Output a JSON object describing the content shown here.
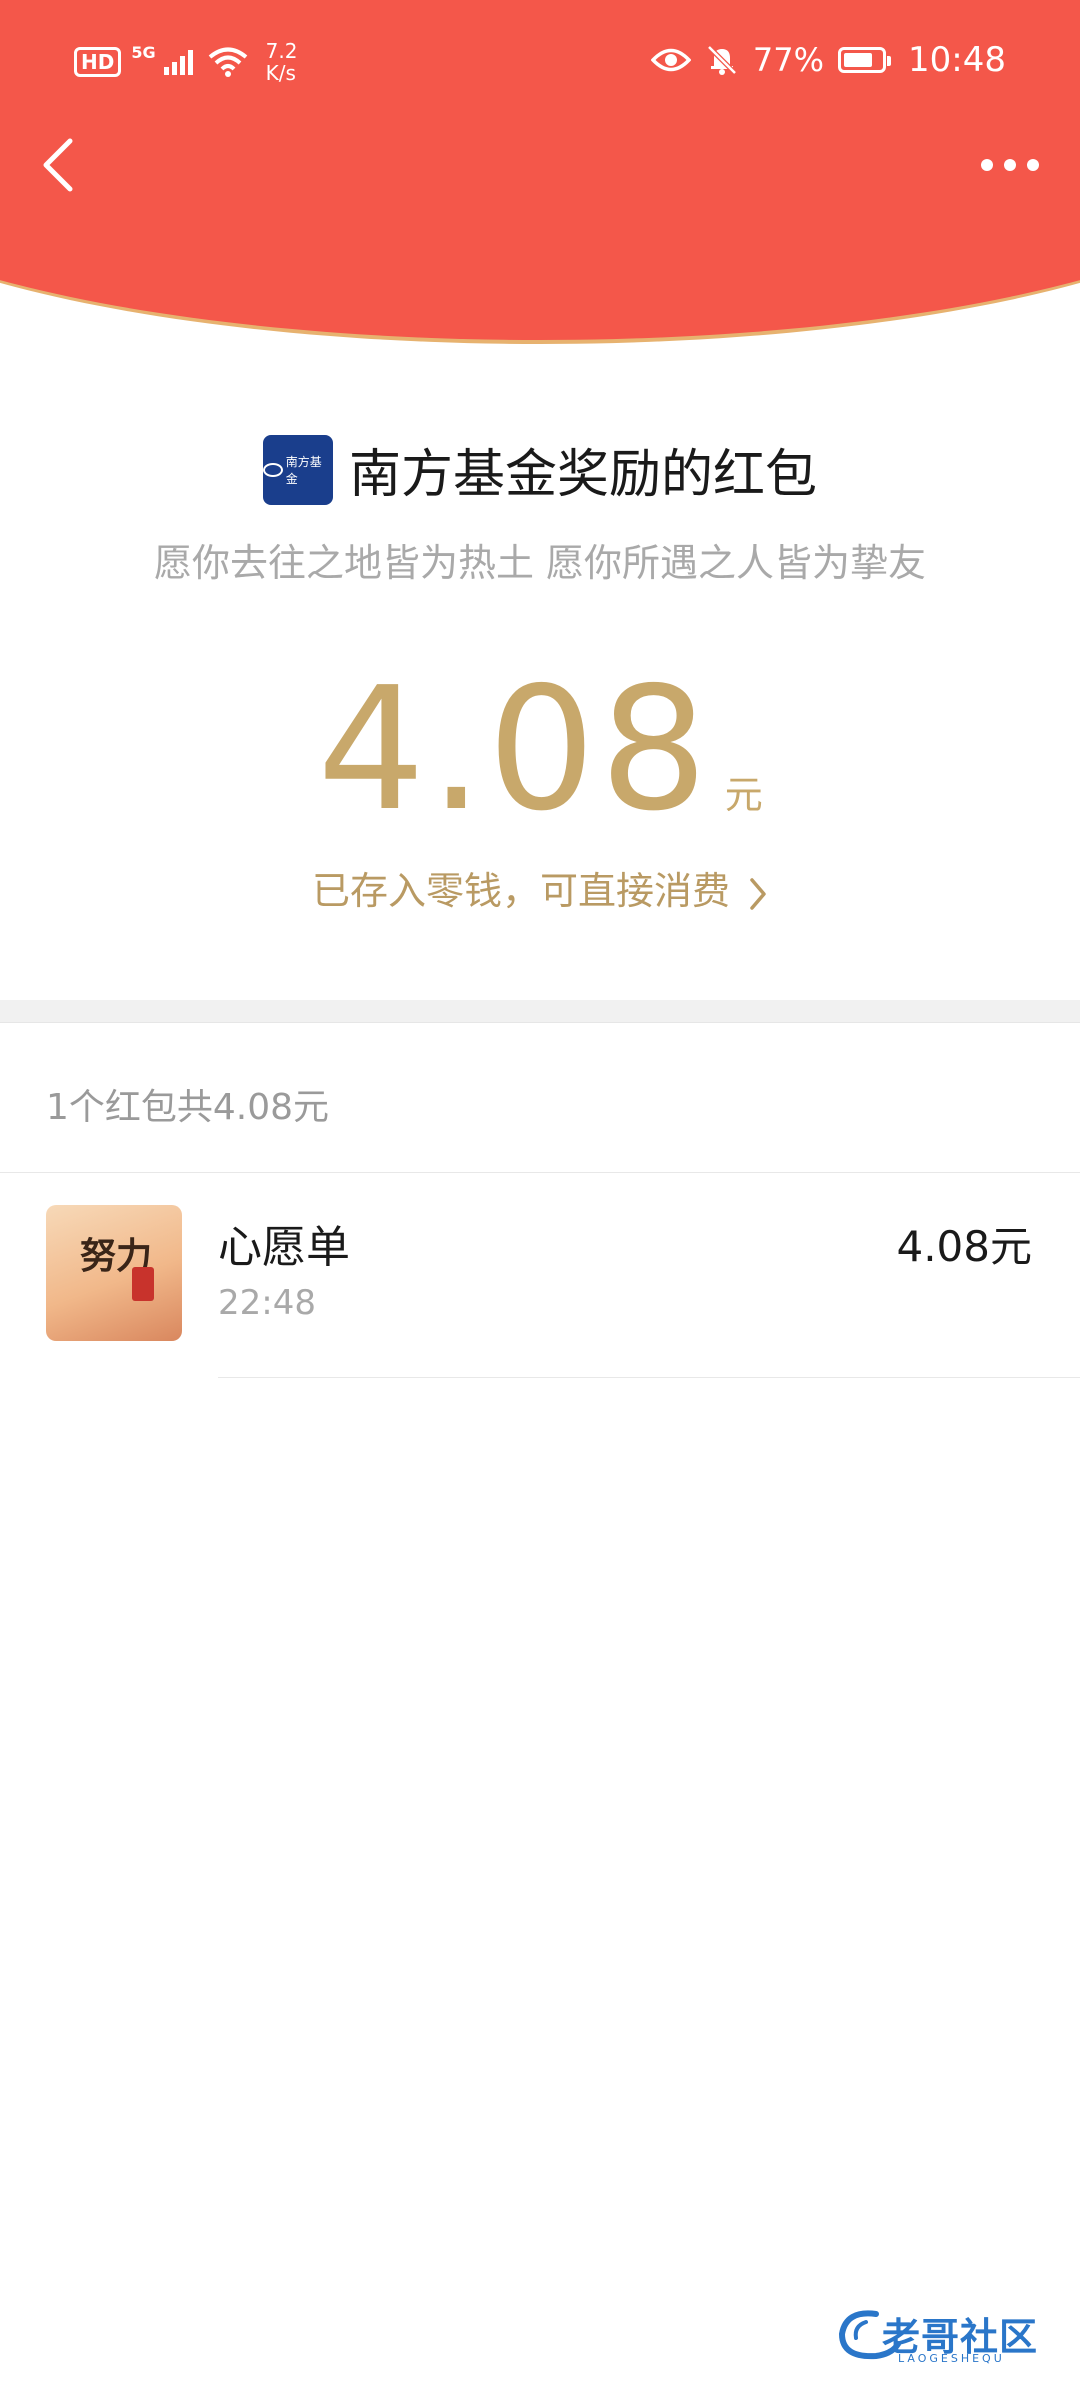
{
  "status_bar": {
    "hd": "HD",
    "network": "5G",
    "speed_value": "7.2",
    "speed_unit": "K/s",
    "battery": "77%",
    "battery_level": 0.77,
    "time": "10:48"
  },
  "nav": {
    "back_icon": "chevron-left-icon",
    "more_icon": "more-horizontal-icon"
  },
  "header": {
    "sender_logo_text": "南方基金",
    "sender_title": "南方基金奖励的红包",
    "blessing": "愿你去往之地皆为热土 愿你所遇之人皆为挚友"
  },
  "amount": {
    "value": "4.08",
    "unit": "元",
    "stored_text": "已存入零钱，可直接消费"
  },
  "summary": {
    "text": "1个红包共4.08元"
  },
  "list": {
    "items": [
      {
        "name": "心愿单",
        "time": "22:48",
        "amount": "4.08元",
        "avatar_text": "努力"
      }
    ]
  },
  "watermark": {
    "text": "老哥社区",
    "subtext": "LAOGESHEQU"
  },
  "colors": {
    "header_red": "#f4574a",
    "gold": "#c8a86b",
    "watermark_blue": "#2a76c9"
  }
}
